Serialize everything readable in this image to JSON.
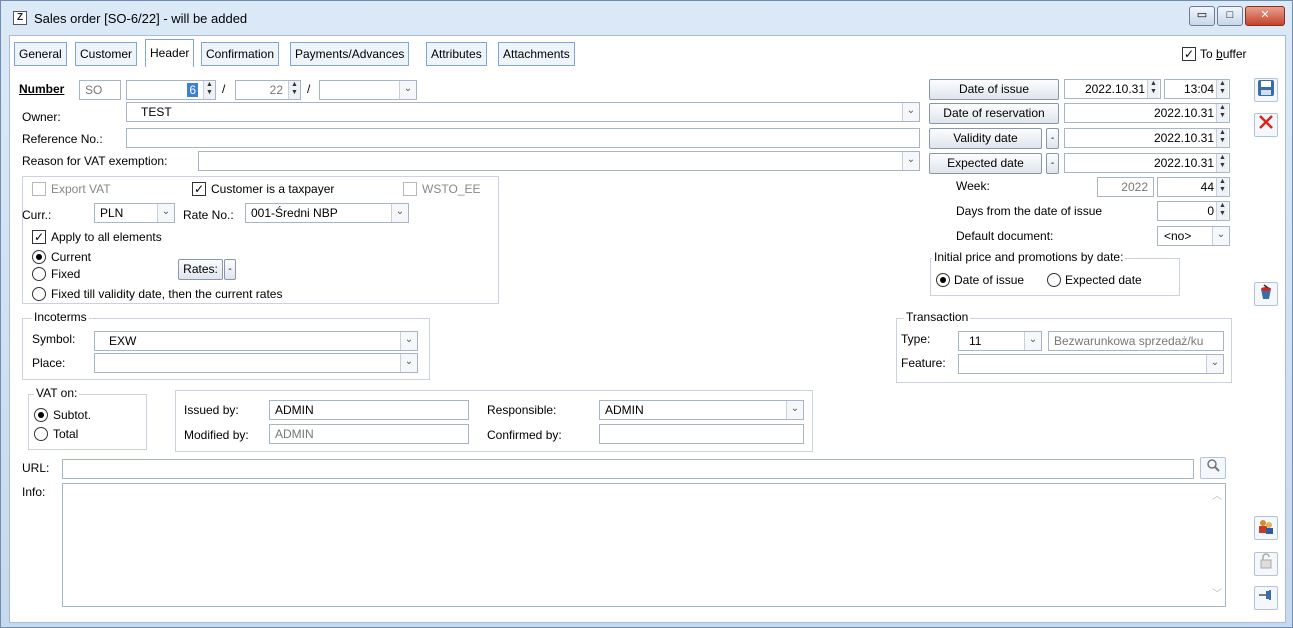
{
  "window": {
    "title": "Sales order [SO-6/22] - will be added",
    "app_icon": "Z",
    "controls": {
      "minimize": "▭",
      "maximize": "□",
      "close": "✕"
    }
  },
  "tabs": [
    "General",
    "Customer",
    "Header",
    "Confirmation",
    "Payments/Advances",
    "Attributes",
    "Attachments"
  ],
  "to_buffer": {
    "label_pre": "To ",
    "label_u": "b",
    "label_post": "uffer",
    "checked": "✓"
  },
  "number": {
    "label": "Number",
    "prefix": "SO",
    "value": "6",
    "year": "22",
    "sep": "/",
    "suffix": ""
  },
  "owner": {
    "label": "Owner:",
    "value": "TEST"
  },
  "reference": {
    "label": "Reference No.:",
    "value": ""
  },
  "vat_exemption": {
    "label": "Reason for VAT exemption:",
    "value": ""
  },
  "vat_box": {
    "export_vat": "Export VAT",
    "taxpayer": "Customer is a taxpayer",
    "taxpayer_check": "✓",
    "wsto": "WSTO_EE",
    "curr_label": "Curr.:",
    "curr_value": "PLN",
    "rate_label": "Rate No.:",
    "rate_value": "001-Średni NBP",
    "apply_all": "Apply to all elements",
    "apply_check": "✓",
    "current": "Current",
    "fixed": "Fixed",
    "rates_btn": "Rates:",
    "fixed_till": "Fixed till validity date, then the current rates"
  },
  "dates": {
    "issue_btn": "Date of issue",
    "issue_date": "2022.10.31",
    "issue_time": "13:04",
    "reservation_btn": "Date of reservation",
    "reservation_date": "2022.10.31",
    "validity_btn": "Validity date",
    "validity_date": "2022.10.31",
    "expected_btn": "Expected date",
    "expected_date": "2022.10.31",
    "week_label": "Week:",
    "week_year": "2022",
    "week_no": "44",
    "days_label": "Days from the date of issue",
    "days_value": "0",
    "default_doc_label": "Default document:",
    "default_doc_value": "<no>"
  },
  "initial_price": {
    "title": "Initial price and promotions by date:",
    "issue": "Date of issue",
    "expected": "Expected date"
  },
  "incoterms": {
    "title": "Incoterms",
    "symbol_label": "Symbol:",
    "symbol_value": "EXW",
    "place_label": "Place:",
    "place_value": ""
  },
  "transaction": {
    "title": "Transaction",
    "type_label": "Type:",
    "type_value": "11",
    "type_desc": "Bezwarunkowa sprzedaż/ku",
    "feature_label": "Feature:",
    "feature_value": ""
  },
  "vat_on": {
    "title": "VAT on:",
    "subtot": "Subtot.",
    "total": "Total"
  },
  "users": {
    "issued_label": "Issued by:",
    "issued_value": "ADMIN",
    "modified_label": "Modified by:",
    "modified_value": "ADMIN",
    "responsible_label": "Responsible:",
    "responsible_value": "ADMIN",
    "confirmed_label": "Confirmed by:",
    "confirmed_value": ""
  },
  "url": {
    "label": "URL:",
    "value": ""
  },
  "info": {
    "label": "Info:",
    "value": ""
  },
  "glyphs": {
    "chev": "⌄",
    "spin_up": "▲",
    "spin_down": "▼",
    "dash": "-"
  },
  "colors": {
    "accent": "#3a6ea5",
    "selection": "#3b7fd8"
  }
}
